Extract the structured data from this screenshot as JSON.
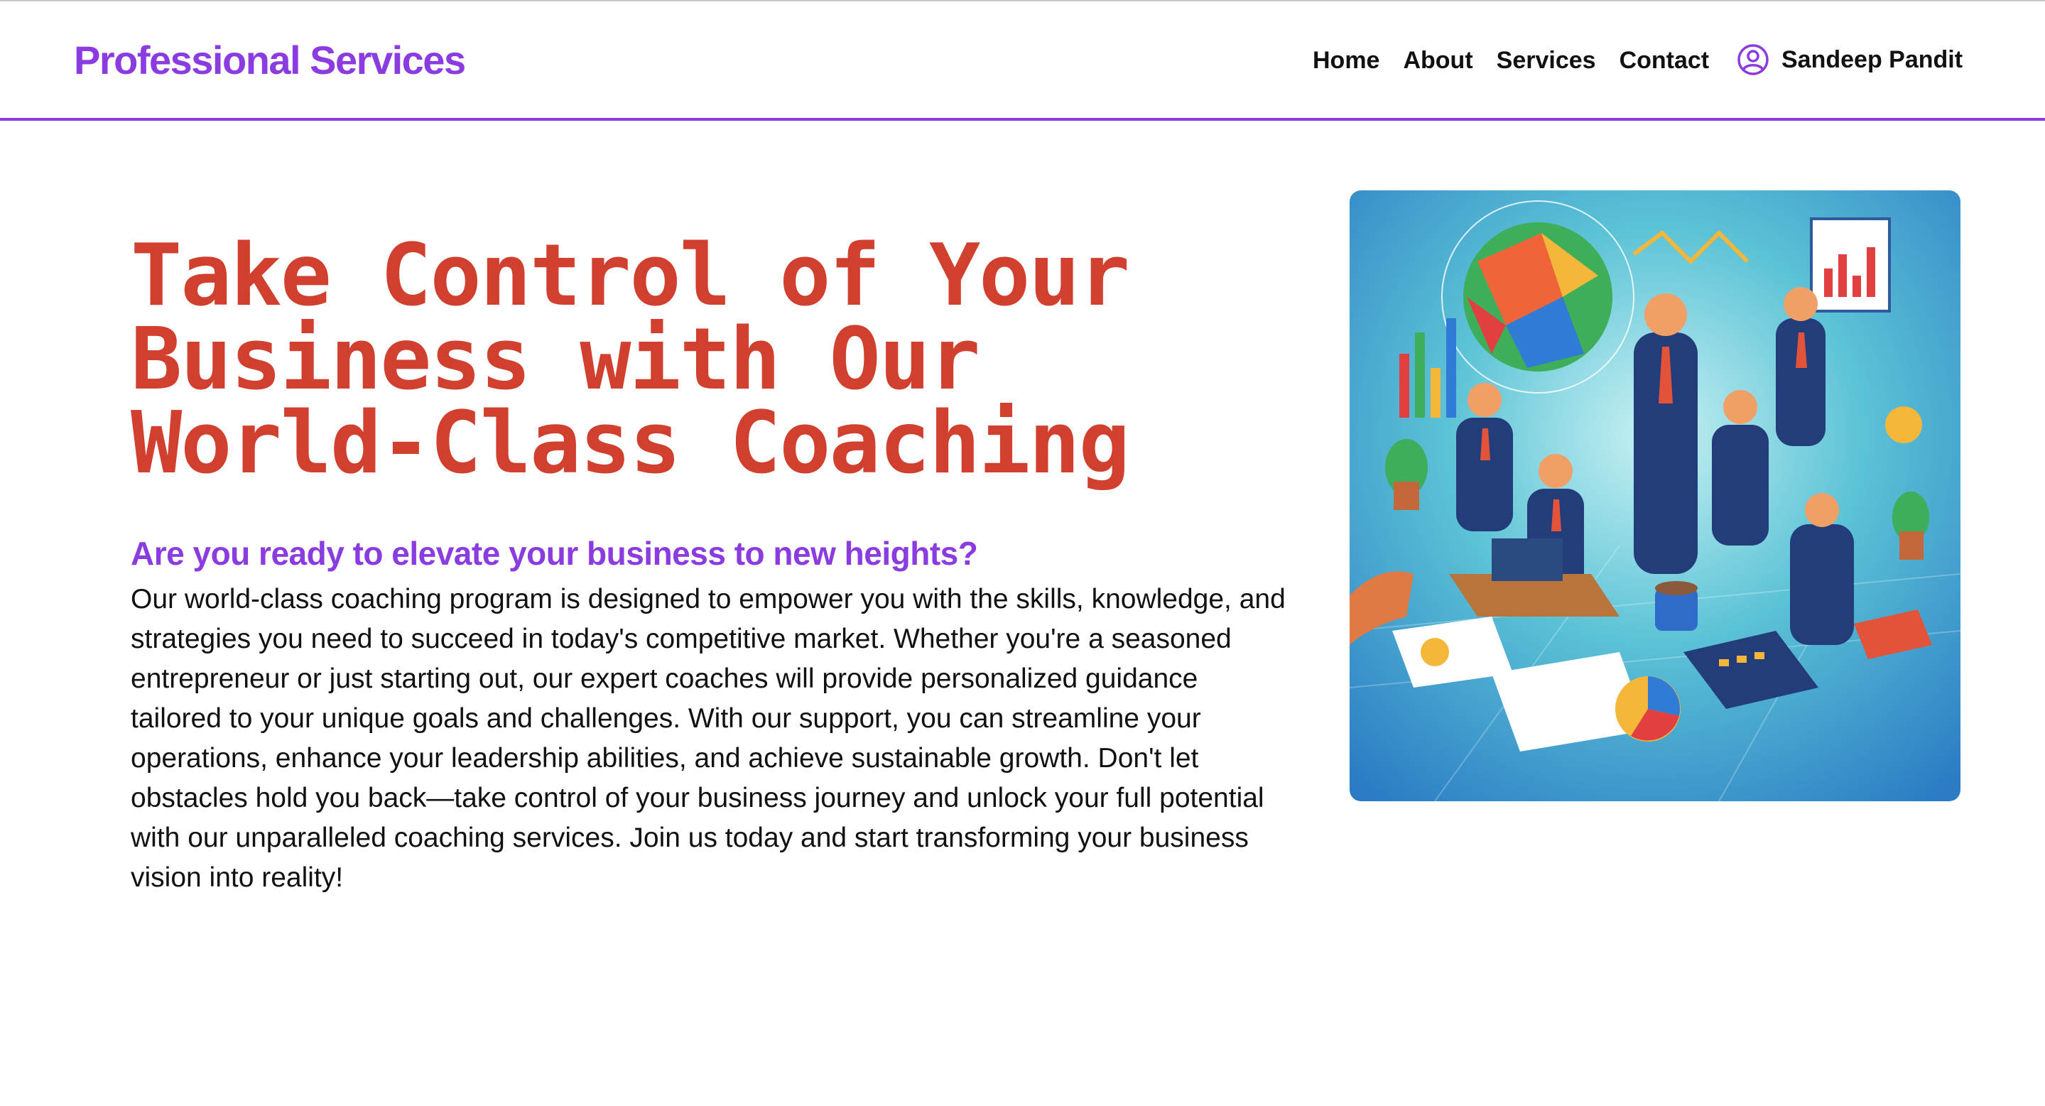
{
  "header": {
    "brand": "Professional Services",
    "nav": [
      "Home",
      "About",
      "Services",
      "Contact"
    ],
    "user": {
      "name": "Sandeep Pandit",
      "icon": "user-circle-icon"
    }
  },
  "hero": {
    "title": "Take Control of Your Business with Our World-Class Coaching",
    "lead": "Are you ready to elevate your business to new heights?",
    "body": "Our world-class coaching program is designed to empower you with the skills, knowledge, and strategies you need to succeed in today's competitive market. Whether you're a seasoned entrepreneur or just starting out, our expert coaches will provide personalized guidance tailored to your unique goals and challenges. With our support, you can streamline your operations, enhance your leadership abilities, and achieve sustainable growth. Don't let obstacles hold you back—take control of your business journey and unlock your full potential with our unparalleled coaching services. Join us today and start transforming your business vision into reality!"
  },
  "colors": {
    "brand": "#8a3ce0",
    "title": "#d13f2f",
    "text": "#111111"
  }
}
